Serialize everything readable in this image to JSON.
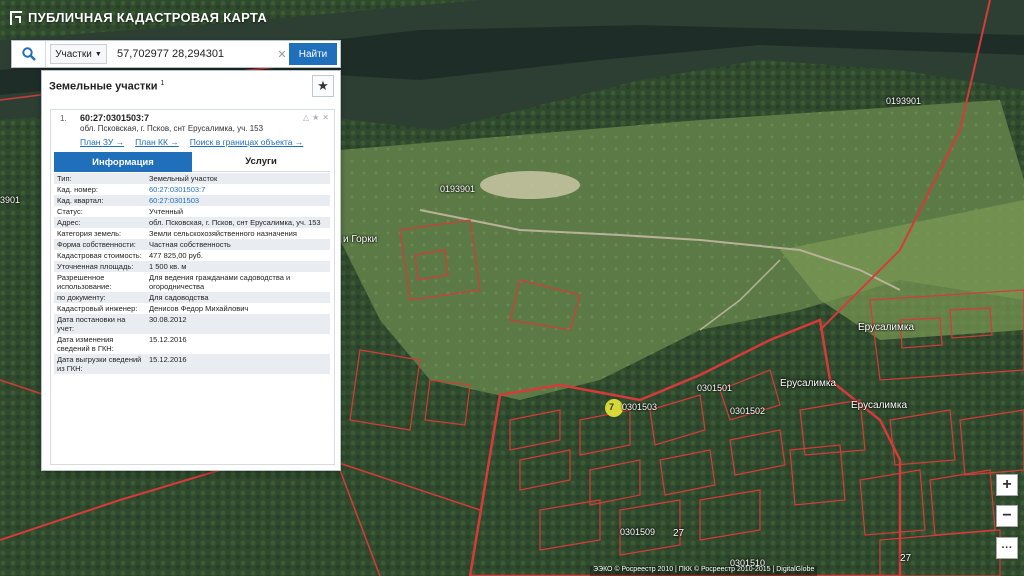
{
  "app": {
    "title": "ПУБЛИЧНАЯ КАДАСТРОВАЯ КАРТА"
  },
  "search": {
    "type_label": "Участки",
    "value": "57,702977 28,294301",
    "find_label": "Найти"
  },
  "panel": {
    "title": "Земельные участки",
    "title_count": "1",
    "result": {
      "number": "1.",
      "cad_id": "60:27:0301503:7",
      "address": "обл. Псковская, г. Псков, снт Ерусалимка, уч. 153",
      "links": [
        "План ЗУ →",
        "План КК →",
        "Поиск в границах объекта →"
      ],
      "tabs": {
        "active": "Информация",
        "inactive": "Услуги"
      },
      "rows": [
        {
          "k": "Тип:",
          "v": "Земельный участок"
        },
        {
          "k": "Кад. номер:",
          "v": "60:27:0301503:7"
        },
        {
          "k": "Кад. квартал:",
          "v": "60:27:0301503"
        },
        {
          "k": "Статус:",
          "v": "Учтенный"
        },
        {
          "k": "Адрес:",
          "v": "обл. Псковская, г. Псков, снт Ерусалимка, уч. 153"
        },
        {
          "k": "Категория земель:",
          "v": "Земли сельскохозяйственного назначения"
        },
        {
          "k": "Форма собственности:",
          "v": "Частная собственность"
        },
        {
          "k": "Кадастровая стоимость:",
          "v": "477 825,00 руб."
        },
        {
          "k": "Уточненная площадь:",
          "v": "1 500 кв. м"
        },
        {
          "k": "Разрешенное использование:",
          "v": "Для ведения гражданами садоводства и огородничества"
        },
        {
          "k": "по документу:",
          "v": "Для садоводства"
        },
        {
          "k": "Кадастровый инженер:",
          "v": "Денисов Федор Михайлович"
        },
        {
          "k": "Дата постановки на учет:",
          "v": "30.08.2012"
        },
        {
          "k": "Дата изменения сведений в ГКН:",
          "v": "15.12.2016"
        },
        {
          "k": "Дата выгрузки сведений из ГКН:",
          "v": "15.12.2016"
        }
      ]
    }
  },
  "map": {
    "labels": {
      "q1": "0193901",
      "q2": "0193901",
      "q3": "0301501",
      "q4": "0301502",
      "q5": "0301503",
      "q6": "0301509",
      "q7": "0301510",
      "v1": "Ерусалимка",
      "v2": "Ерусалимка",
      "v3": "Ерусалимка",
      "gorki": "и Горки",
      "q_left": "3901",
      "n27a": "27",
      "n27b": "27",
      "marker": "7"
    },
    "attribution": "ЭЭКО © Росреестр 2010 | ПКК © Росреестр 2010-2015 | DigitalGlobe"
  },
  "zoom": {
    "in": "+",
    "out": "−",
    "more": "···"
  },
  "colors": {
    "accent": "#1f6fba",
    "parcel": "#d63a3a",
    "marker": "#e8e83a"
  }
}
